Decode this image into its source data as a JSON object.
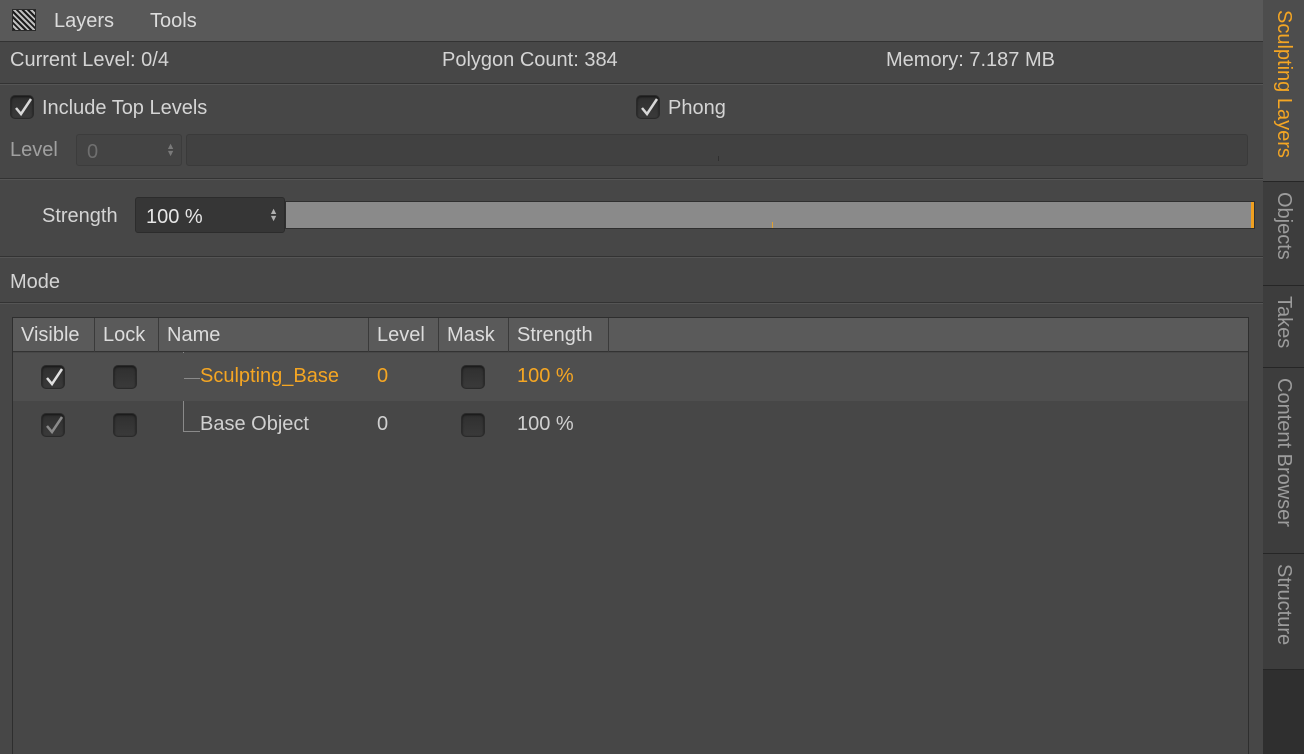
{
  "menu": {
    "items": [
      "Layers",
      "Tools"
    ],
    "grip_icon": "grip-icon"
  },
  "info": {
    "current_level": "Current Level:  0/4",
    "polygon_count": "Polygon Count:  384",
    "memory": "Memory:  7.187 MB"
  },
  "options": {
    "include_top_levels": {
      "label": "Include Top Levels",
      "checked": true
    },
    "phong": {
      "label": "Phong",
      "checked": true
    }
  },
  "level": {
    "label": "Level",
    "value": "0"
  },
  "strength": {
    "label": "Strength",
    "value": "100 %",
    "fraction": 1.0
  },
  "mode": {
    "label": "Mode"
  },
  "table": {
    "columns": [
      "Visible",
      "Lock",
      "Name",
      "Level",
      "Mask",
      "Strength"
    ],
    "rows": [
      {
        "visible": true,
        "lock": false,
        "name": "Sculpting_Base",
        "level": "0",
        "mask": false,
        "strength": "100 %",
        "selected": true
      },
      {
        "visible": true,
        "lock": false,
        "name": "Base Object",
        "level": "0",
        "mask": false,
        "strength": "100 %",
        "selected": false
      }
    ]
  },
  "side_tabs": [
    "Sculpting Layers",
    "Objects",
    "Takes",
    "Content Browser",
    "Structure"
  ],
  "colors": {
    "accent": "#f5a623",
    "panel": "#474747",
    "header": "#5a5a5a"
  }
}
